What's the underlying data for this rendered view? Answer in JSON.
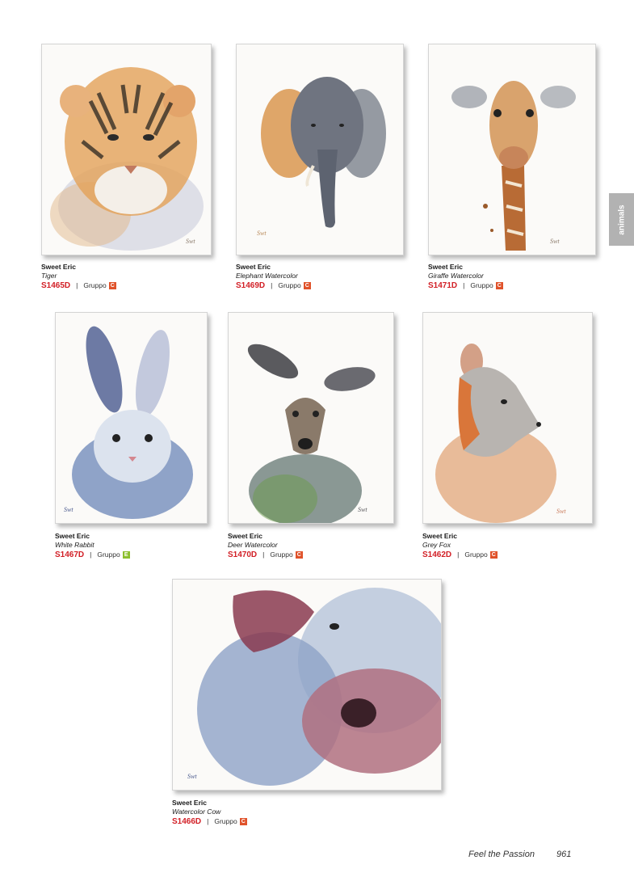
{
  "side_tab": "animals",
  "footer": {
    "slogan": "Feel the Passion",
    "page_number": "961"
  },
  "colors": {
    "code_red": "#d21f26",
    "badge_c": "#e0522a",
    "badge_e": "#8cbf2d",
    "tab_grey": "#b2b2b2"
  },
  "products": [
    {
      "artist": "Sweet Eric",
      "title": "Tiger",
      "code": "S1465D",
      "group_label": "Gruppo",
      "group": "C",
      "image": "tiger-watercolor"
    },
    {
      "artist": "Sweet Eric",
      "title": "Elephant Watercolor",
      "code": "S1469D",
      "group_label": "Gruppo",
      "group": "C",
      "image": "elephant-watercolor"
    },
    {
      "artist": "Sweet Eric",
      "title": "Giraffe Watercolor",
      "code": "S1471D",
      "group_label": "Gruppo",
      "group": "C",
      "image": "giraffe-watercolor"
    },
    {
      "artist": "Sweet Eric",
      "title": "White Rabbit",
      "code": "S1467D",
      "group_label": "Gruppo",
      "group": "E",
      "image": "rabbit-watercolor"
    },
    {
      "artist": "Sweet Eric",
      "title": "Deer Watercolor",
      "code": "S1470D",
      "group_label": "Gruppo",
      "group": "C",
      "image": "deer-watercolor"
    },
    {
      "artist": "Sweet Eric",
      "title": "Grey Fox",
      "code": "S1462D",
      "group_label": "Gruppo",
      "group": "C",
      "image": "fox-watercolor"
    },
    {
      "artist": "Sweet Eric",
      "title": "Watercolor Cow",
      "code": "S1466D",
      "group_label": "Gruppo",
      "group": "C",
      "image": "cow-watercolor"
    }
  ]
}
